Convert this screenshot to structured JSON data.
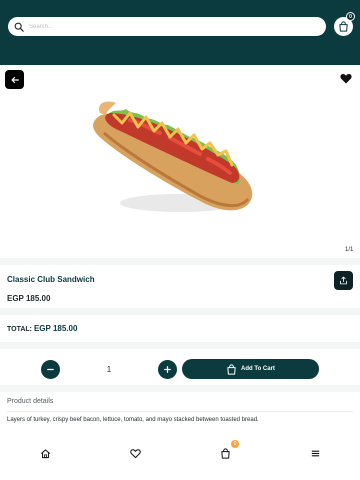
{
  "header": {
    "search_placeholder": "Search...",
    "cart_count": "0"
  },
  "gallery": {
    "counter": "1/1",
    "image_alt": "hot dog sandwich"
  },
  "product": {
    "title": "Classic Club Sandwich",
    "price": "EGP 185.00"
  },
  "total": {
    "label": "TOTAL:",
    "value": "EGP 185.00"
  },
  "quantity": {
    "value": "1"
  },
  "actions": {
    "add_to_cart_label": "Add To Cart"
  },
  "details": {
    "heading": "Product details",
    "text": "Layers of turkey, crispy beef bacon, lettuce, tomato, and mayo stacked between toasted bread."
  },
  "bottom_nav": {
    "items": [
      "home-icon",
      "heart-icon",
      "cart-icon",
      "menu-icon"
    ],
    "cart_badge": "0"
  },
  "colors": {
    "primary": "#0b3a3f",
    "badge": "#f3a33a",
    "background": "#ffffff"
  }
}
